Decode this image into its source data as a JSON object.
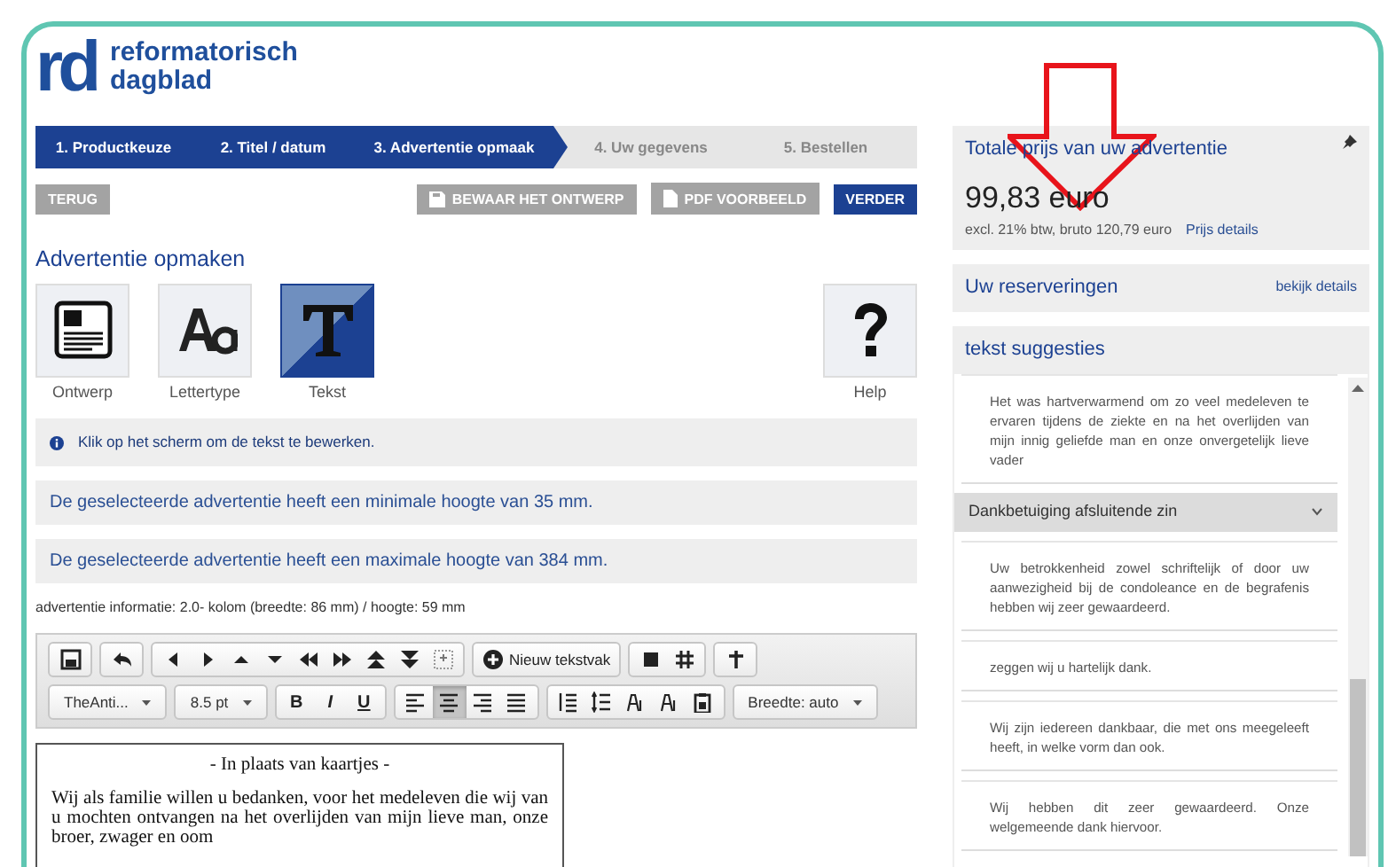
{
  "logo": {
    "mark": "rd",
    "line1": "reformatorisch",
    "line2": "dagblad"
  },
  "steps": [
    {
      "label": "1. Productkeuze",
      "done": true
    },
    {
      "label": "2. Titel / datum",
      "done": true
    },
    {
      "label": "3. Advertentie opmaak",
      "done": true
    },
    {
      "label": "4. Uw gegevens",
      "done": false
    },
    {
      "label": "5. Bestellen",
      "done": false
    }
  ],
  "actions": {
    "back": "TERUG",
    "save": "BEWAAR HET ONTWERP",
    "pdf": "PDF VOORBEELD",
    "next": "VERDER"
  },
  "section_title": "Advertentie opmaken",
  "tools": [
    {
      "label": "Ontwerp",
      "kind": "design",
      "selected": false
    },
    {
      "label": "Lettertype",
      "kind": "font",
      "selected": false
    },
    {
      "label": "Tekst",
      "kind": "text",
      "selected": true
    },
    {
      "label": "Help",
      "kind": "help",
      "selected": false
    }
  ],
  "info": "Klik op het scherm om de tekst te bewerken.",
  "notices": [
    "De geselecteerde advertentie heeft een minimale hoogte van 35 mm.",
    "De geselecteerde advertentie heeft een maximale hoogte van 384 mm."
  ],
  "ad_info": "advertentie informatie: 2.0- kolom (breedte: 86 mm) / hoogte: 59 mm",
  "editor": {
    "new_box": "Nieuw tekstvak",
    "font": "TheAnti...",
    "size": "8.5 pt",
    "bold": "B",
    "italic": "I",
    "underline": "U",
    "alignment": [
      {
        "selected": false
      },
      {
        "selected": true
      },
      {
        "selected": false
      },
      {
        "selected": false
      }
    ],
    "width": "Breedte: auto"
  },
  "preview": {
    "title": "- In plaats van kaartjes -",
    "body": "Wij als familie willen u bedanken, voor het medeleven die wij van u mochten ontvangen na het overlijden van mijn lieve man, onze broer, zwager en oom"
  },
  "price": {
    "title": "Totale prijs van uw advertentie",
    "amount": "99,83 euro",
    "detail": "excl. 21% btw, bruto 120,79 euro",
    "link": "Prijs details"
  },
  "reservations": {
    "title": "Uw reserveringen",
    "link": "bekijk details"
  },
  "suggestions": {
    "title": "tekst suggesties",
    "items": [
      "Het was hartverwarmend om zo veel medeleven te ervaren tijdens de ziekte en na het overlijden van mijn innig geliefde man en onze onvergetelijk lieve vader"
    ],
    "group": {
      "title": "Dankbetuiging afsluitende zin",
      "expanded": true,
      "items": [
        "Uw betrokkenheid zowel schriftelijk of door uw aanwezigheid bij de condoleance en de begrafenis hebben wij zeer gewaardeerd.",
        "zeggen wij u hartelijk dank.",
        "Wij zijn iedereen dankbaar, die met ons meegeleeft heeft, in welke vorm dan ook.",
        "Wij hebben dit zeer gewaardeerd. Onze welgemeende dank hiervoor."
      ]
    }
  }
}
